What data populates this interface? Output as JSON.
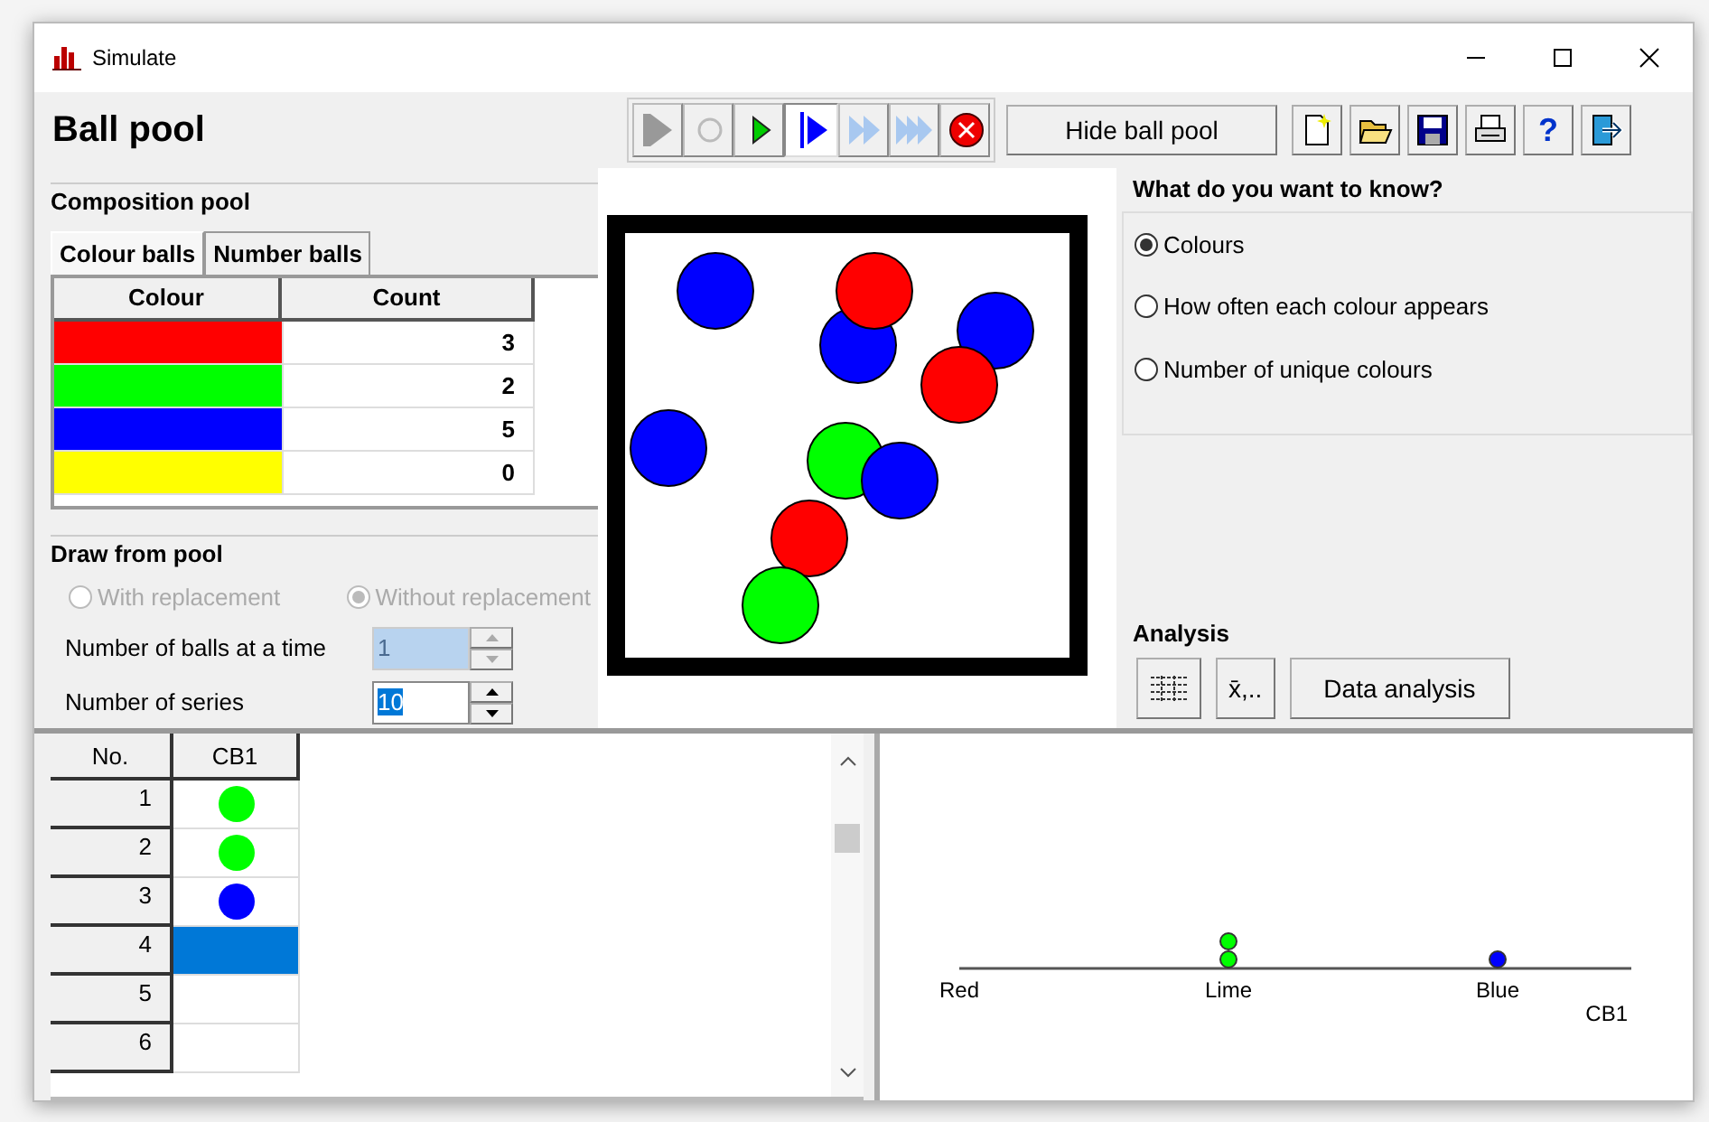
{
  "window": {
    "title": "Simulate"
  },
  "heading": "Ball pool",
  "playback_buttons": [
    {
      "kind": "play",
      "disabled": true,
      "pressed": false
    },
    {
      "kind": "record",
      "disabled": true,
      "pressed": false
    },
    {
      "kind": "step",
      "disabled": false,
      "pressed": false
    },
    {
      "kind": "run",
      "disabled": false,
      "pressed": true
    },
    {
      "kind": "fast",
      "disabled": true,
      "pressed": false
    },
    {
      "kind": "fastest",
      "disabled": true,
      "pressed": false
    },
    {
      "kind": "stop",
      "disabled": false,
      "pressed": false
    }
  ],
  "pool_toggle_button": "Hide ball pool",
  "file_buttons": [
    {
      "kind": "new"
    },
    {
      "kind": "open"
    },
    {
      "kind": "save"
    },
    {
      "kind": "print"
    },
    {
      "kind": "help",
      "label": "?"
    },
    {
      "kind": "exit"
    }
  ],
  "composition_pool": {
    "title": "Composition pool",
    "tabs": [
      {
        "label": "Colour balls",
        "selected": true
      },
      {
        "label": "Number balls",
        "selected": false
      }
    ],
    "columns": [
      "Colour",
      "Count"
    ],
    "rows": [
      {
        "color": "#ff0000",
        "count": "3"
      },
      {
        "color": "#00ff00",
        "count": "2"
      },
      {
        "color": "#0000ff",
        "count": "5"
      },
      {
        "color": "#ffff00",
        "count": "0"
      }
    ]
  },
  "draw_from_pool": {
    "title": "Draw from pool",
    "disabled": true,
    "options": [
      {
        "label": "With replacement",
        "selected": false
      },
      {
        "label": "Without replacement",
        "selected": true
      }
    ],
    "fields": [
      {
        "label": "Number of balls at a time",
        "value": "1",
        "disabled": true
      },
      {
        "label": "Number of series",
        "value": "10",
        "disabled": false
      }
    ]
  },
  "pool_balls": [
    {
      "color": "#0000ff"
    },
    {
      "color": "#0000ff"
    },
    {
      "color": "#ff0000"
    },
    {
      "color": "#0000ff"
    },
    {
      "color": "#ff0000"
    },
    {
      "color": "#0000ff"
    },
    {
      "color": "#00ff00"
    },
    {
      "color": "#0000ff"
    },
    {
      "color": "#ff0000"
    },
    {
      "color": "#00ff00"
    }
  ],
  "question": {
    "title": "What do you want to know?",
    "options": [
      {
        "label": "Colours",
        "selected": true
      },
      {
        "label": "How often each colour appears",
        "selected": false
      },
      {
        "label": "Number of unique colours",
        "selected": false
      }
    ]
  },
  "analysis": {
    "title": "Analysis",
    "buttons": [
      {
        "kind": "table"
      },
      {
        "kind": "text",
        "label": "x̄,.."
      },
      {
        "kind": "text",
        "label": "Data analysis"
      }
    ]
  },
  "results": {
    "columns": [
      "No.",
      "CB1"
    ],
    "rows": [
      {
        "no": "1",
        "color": "#00ff00",
        "selected": false
      },
      {
        "no": "2",
        "color": "#00ff00",
        "selected": false
      },
      {
        "no": "3",
        "color": "#0000ff",
        "selected": false
      },
      {
        "no": "4",
        "selected": true
      },
      {
        "no": "5",
        "selected": false
      },
      {
        "no": "6",
        "selected": false
      }
    ]
  },
  "dot_plot": {
    "xlabel": "CB1",
    "categories": [
      {
        "label": "Red"
      },
      {
        "label": "Lime",
        "dots": [
          {
            "color": "#00ff00"
          },
          {
            "color": "#00ff00"
          }
        ]
      },
      {
        "label": "Blue",
        "dots": [
          {
            "color": "#0000ff"
          }
        ]
      }
    ]
  }
}
